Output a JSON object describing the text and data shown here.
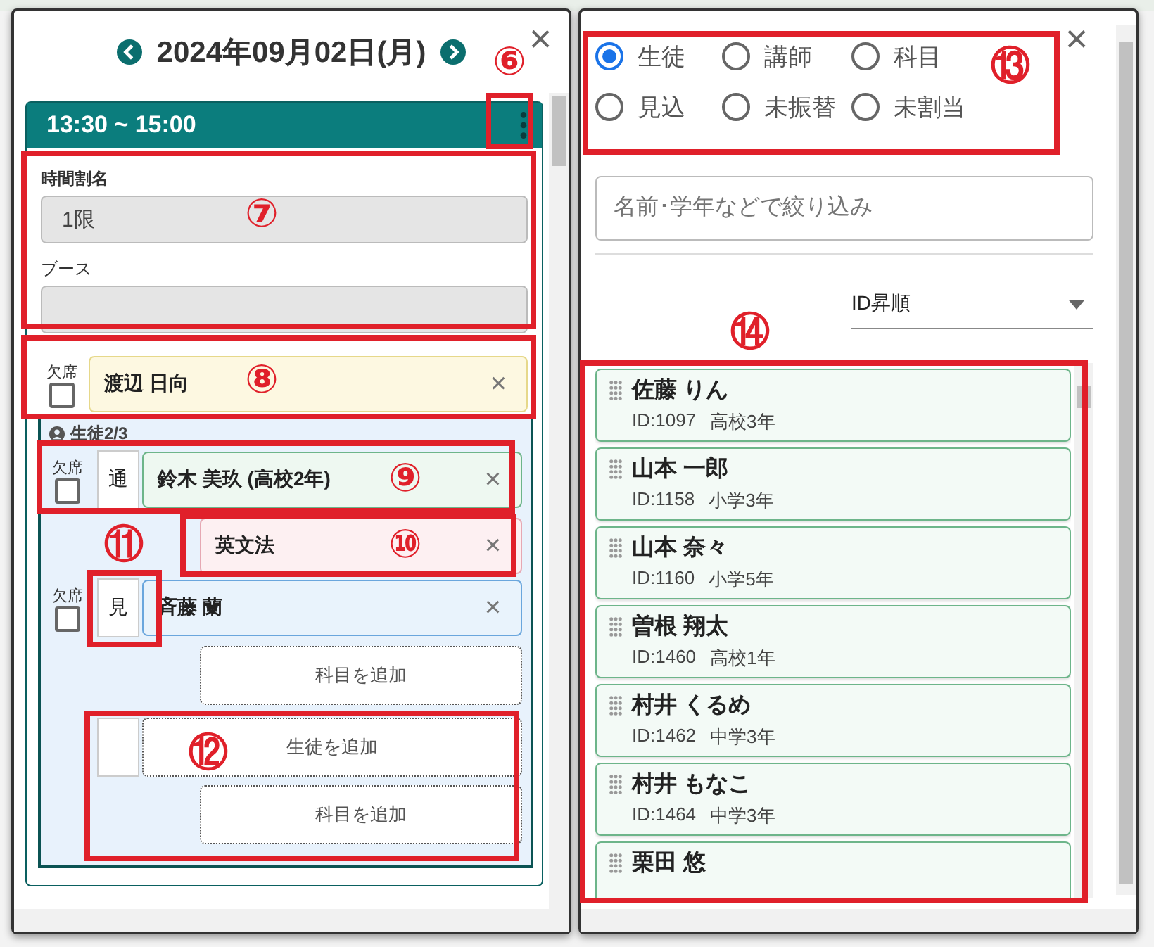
{
  "left_panel": {
    "date": "2024年09月02日(月)",
    "close": "×",
    "time": "13:30 ~ 15:00",
    "fields": [
      {
        "label": "時間割名",
        "value": "1限"
      },
      {
        "label": "ブース"
      }
    ],
    "teacher": {
      "absent_label": "欠席",
      "absent": false,
      "name": "渡辺 日向",
      "remove": "×"
    },
    "students_header": "生徒2/3",
    "students": [
      {
        "absent_label": "欠席",
        "absent": false,
        "badge": "通",
        "name": "鈴木 美玖 (高校2年)",
        "remove": "×",
        "subjects": [
          {
            "name": "英文法",
            "remove": "×"
          }
        ]
      },
      {
        "absent_label": "欠席",
        "absent": false,
        "badge": "見",
        "name": "斉藤 蘭",
        "remove": "×",
        "add_subject": "科目を追加"
      }
    ],
    "add_student": "生徒を追加",
    "add_subject": "科目を追加"
  },
  "right_panel": {
    "close": "×",
    "radios": [
      {
        "label": "生徒",
        "selected": true
      },
      {
        "label": "講師",
        "selected": false
      },
      {
        "label": "科目",
        "selected": false
      },
      {
        "label": "見込",
        "selected": false
      },
      {
        "label": "未振替",
        "selected": false
      },
      {
        "label": "未割当",
        "selected": false
      }
    ],
    "search": {
      "placeholder": "名前･学年などで絞り込み"
    },
    "sort": "ID昇順",
    "students": [
      {
        "name": "佐藤 りん",
        "id": "ID:1097",
        "grade": "高校3年"
      },
      {
        "name": "山本 一郎",
        "id": "ID:1158",
        "grade": "小学3年"
      },
      {
        "name": "山本 奈々",
        "id": "ID:1160",
        "grade": "小学5年"
      },
      {
        "name": "曽根 翔太",
        "id": "ID:1460",
        "grade": "高校1年"
      },
      {
        "name": "村井 くるめ",
        "id": "ID:1462",
        "grade": "中学3年"
      },
      {
        "name": "村井 もなこ",
        "id": "ID:1464",
        "grade": "中学3年"
      },
      {
        "name": "栗田 悠"
      }
    ]
  },
  "annotations": [
    {
      "label": "⑥"
    },
    {
      "label": "⑦"
    },
    {
      "label": "⑧"
    },
    {
      "label": "⑨"
    },
    {
      "label": "⑩"
    },
    {
      "label": "⑪"
    },
    {
      "label": "⑫"
    },
    {
      "label": "⑬"
    },
    {
      "label": "⑭"
    }
  ]
}
